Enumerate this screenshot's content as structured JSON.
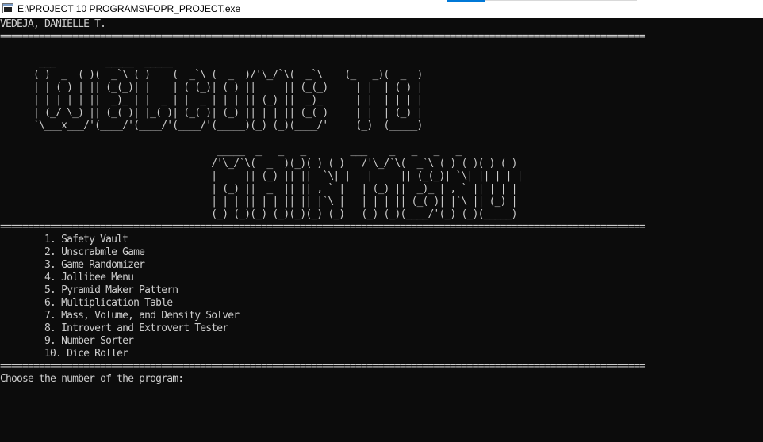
{
  "window": {
    "title": "E:\\PROJECT 10 PROGRAMS\\FOPR_PROJECT.exe",
    "icon": "console-app-icon"
  },
  "colors": {
    "console_bg": "#0c0c0c",
    "console_text": "#cccccc",
    "titlebar_bg": "#ffffff",
    "accent": "#0078d7"
  },
  "console": {
    "author": "VEDEJA, DANIELLE T.",
    "separator": "====================================================================================================================",
    "banner_welcome": [
      "       ___         _____  _____",
      "      ( )  _  ( )(  _`\\ ( )    (  _`\\ (  _  )/'\\_/`\\(  _`\\    (_   _)(  _  )",
      "      | | ( ) | || (_(_)| |    | ( (_)| ( ) ||     || (_(_)     | |  | ( ) |",
      "      | | | | | ||  _)_ | |  _ | |  _ | | | || (_) ||  _)_      | |  | | | |",
      "      | (_/ \\_) || (_( )| |_( )| (_( )| (_) || | | || (_( )     | |  | (_) |",
      "      `\\___x___/'(____/'(____/'(____/'(_____)(_) (_)(____/'     (_)  (_____)"
    ],
    "banner_main_menu": [
      "                                       _____  _   _   _        ___    _   _   _   _",
      "                                      /'\\_/`\\(  _  )(_)( ) ( )   /'\\_/`\\(  _`\\ ( ) ( )( ) ( )",
      "                                      |     || (_) || ||  `\\| |   |     || (_(_)| `\\| || | | |",
      "                                      | (_) ||  _  || || , ` |   | (_) ||  _)_ | , ` || | | |",
      "                                      | | | || | | || || |`\\ |   | | | || (_( )| |`\\ || (_) |",
      "                                      (_) (_)(_) (_)(_)(_) (_)   (_) (_)(____/'(_) (_)(_____)"
    ],
    "menu_items": [
      "        1. Safety Vault",
      "        2. Unscrabmle Game",
      "        3. Game Randomizer",
      "        4. Jollibee Menu",
      "        5. Pyramid Maker Pattern",
      "        6. Multiplication Table",
      "        7. Mass, Volume, and Density Solver",
      "        8. Introvert and Extrovert Tester",
      "        9. Number Sorter",
      "        10. Dice Roller"
    ],
    "prompt": "Choose the number of the program: "
  }
}
